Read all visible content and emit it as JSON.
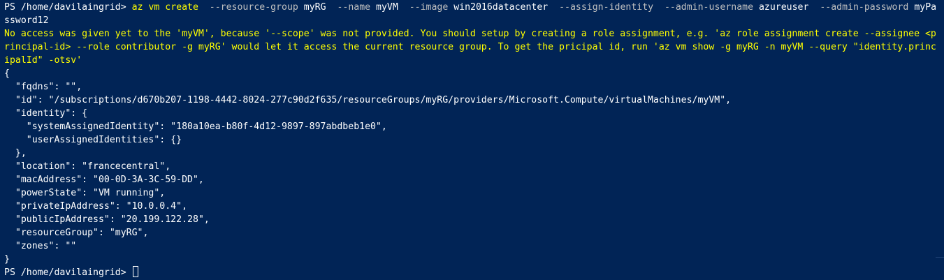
{
  "prompt": "PS /home/davilaingrid> ",
  "command": {
    "exe": "az vm create",
    "parts": [
      {
        "flag": "--resource-group",
        "value": "myRG"
      },
      {
        "flag": "--name",
        "value": "myVM"
      },
      {
        "flag": "--image",
        "value": "win2016datacenter"
      },
      {
        "flag": "--assign-identity",
        "value": ""
      },
      {
        "flag": "--admin-username",
        "value": "azureuser"
      },
      {
        "flag": "--admin-password",
        "value": "myPa"
      }
    ],
    "wrap": "ssword12"
  },
  "warning_lines": [
    "No access was given yet to the 'myVM', because '--scope' was not provided. You should setup by creating a role assignment, e.g. 'az role assignment create --assignee <p",
    "rincipal-id> --role contributor -g myRG' would let it access the current resource group. To get the pricipal id, run 'az vm show -g myRG -n myVM --query \"identity.princ",
    "ipalId\" -otsv'"
  ],
  "output_lines": [
    "{",
    "  \"fqdns\": \"\",",
    "  \"id\": \"/subscriptions/d670b207-1198-4442-8024-277c90d2f635/resourceGroups/myRG/providers/Microsoft.Compute/virtualMachines/myVM\",",
    "  \"identity\": {",
    "    \"systemAssignedIdentity\": \"180a10ea-b80f-4d12-9897-897abdbeb1e0\",",
    "    \"userAssignedIdentities\": {}",
    "  },",
    "  \"location\": \"francecentral\",",
    "  \"macAddress\": \"00-0D-3A-3C-59-DD\",",
    "  \"powerState\": \"VM running\",",
    "  \"privateIpAddress\": \"10.0.0.4\",",
    "  \"publicIpAddress\": \"20.199.122.28\",",
    "  \"resourceGroup\": \"myRG\",",
    "  \"zones\": \"\"",
    "}"
  ],
  "final_prompt": "PS /home/davilaingrid> ",
  "colors": {
    "background": "#012456",
    "text": "#ffffff",
    "command": "#ffff00",
    "flag": "#c0c0c0",
    "warning": "#ffff00"
  }
}
